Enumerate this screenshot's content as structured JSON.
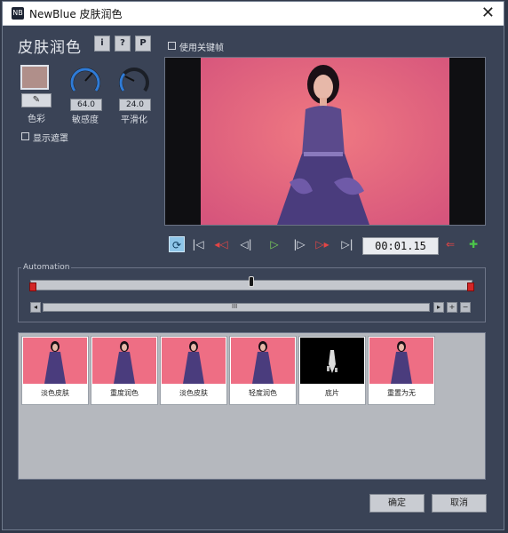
{
  "window": {
    "app_icon": "NB",
    "title": "NewBlue 皮肤润色",
    "close_icon": "✕"
  },
  "panel": {
    "heading": "皮肤润色",
    "info_btn": "i",
    "help_btn": "?",
    "preset_btn": "P",
    "use_keyframes_label": "使用关键帧",
    "show_mask_label": "显示遮罩",
    "color_label": "色彩",
    "picker_icon": "✎",
    "sensitivity": {
      "label": "敏感度",
      "value": "64.0"
    },
    "smoothing": {
      "label": "平滑化",
      "value": "24.0"
    },
    "accent_color": "#b08f8a"
  },
  "transport": {
    "loop_icon": "⟳",
    "to_start_icon": "|◁",
    "prev_key_icon": "◂◁",
    "step_back_icon": "◁|",
    "play_icon": "▷",
    "step_fwd_icon": "|▷",
    "next_key_icon": "▷▸",
    "to_end_icon": "▷|",
    "timecode": "00:01.15",
    "del_key_icon": "⇐",
    "add_key_icon": "✚"
  },
  "automation": {
    "label": "Automation",
    "grip": "III",
    "plus": "+",
    "minus": "−",
    "left": "◂",
    "right": "▸"
  },
  "presets": [
    {
      "label": "淡色皮肤"
    },
    {
      "label": "重度润色"
    },
    {
      "label": "淡色皮肤"
    },
    {
      "label": "轻度润色"
    },
    {
      "label": "底片"
    },
    {
      "label": "重置为无"
    }
  ],
  "buttons": {
    "ok": "确定",
    "cancel": "取消"
  }
}
